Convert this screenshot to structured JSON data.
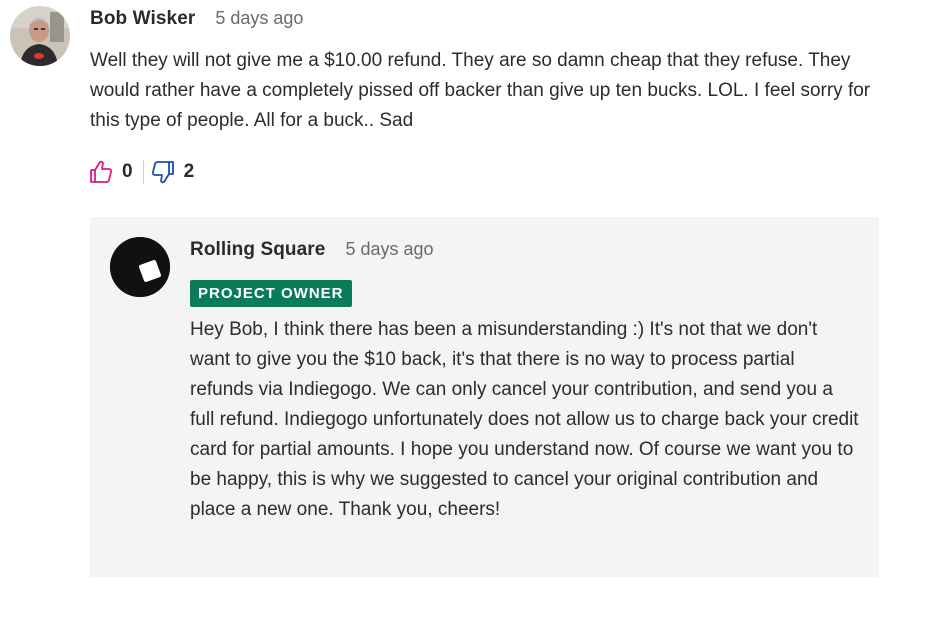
{
  "comment": {
    "author": "Bob Wisker",
    "time": "5 days ago",
    "text": "Well they will not give me a $10.00 refund. They are so damn cheap that they refuse. They would rather have a completely pissed off backer than give up ten bucks. LOL. I feel sorry for this type of people. All for a buck.. Sad",
    "likes": "0",
    "dislikes": "2"
  },
  "reply": {
    "author": "Rolling Square",
    "time": "5 days ago",
    "badge": "PROJECT OWNER",
    "text": "Hey Bob, I think there has been a misunderstanding :) It's not that we don't want to give you the $10 back, it's that there is no way to process partial refunds via Indiegogo. We can only cancel your contribution, and send you a full refund. Indiegogo unfortunately does not allow us to charge back your credit card for partial amounts. I hope you understand now. Of course we want you to be happy, this is why we suggested to cancel your original contribution and place a new one. Thank you, cheers!"
  },
  "colors": {
    "badge": "#0b7c5a",
    "like_icon": "#e0197d",
    "dislike_icon": "#1f4fa8",
    "reply_background": "#f4f4f4"
  },
  "icons": {
    "like": "thumbs-up-icon",
    "dislike": "thumbs-down-icon"
  }
}
